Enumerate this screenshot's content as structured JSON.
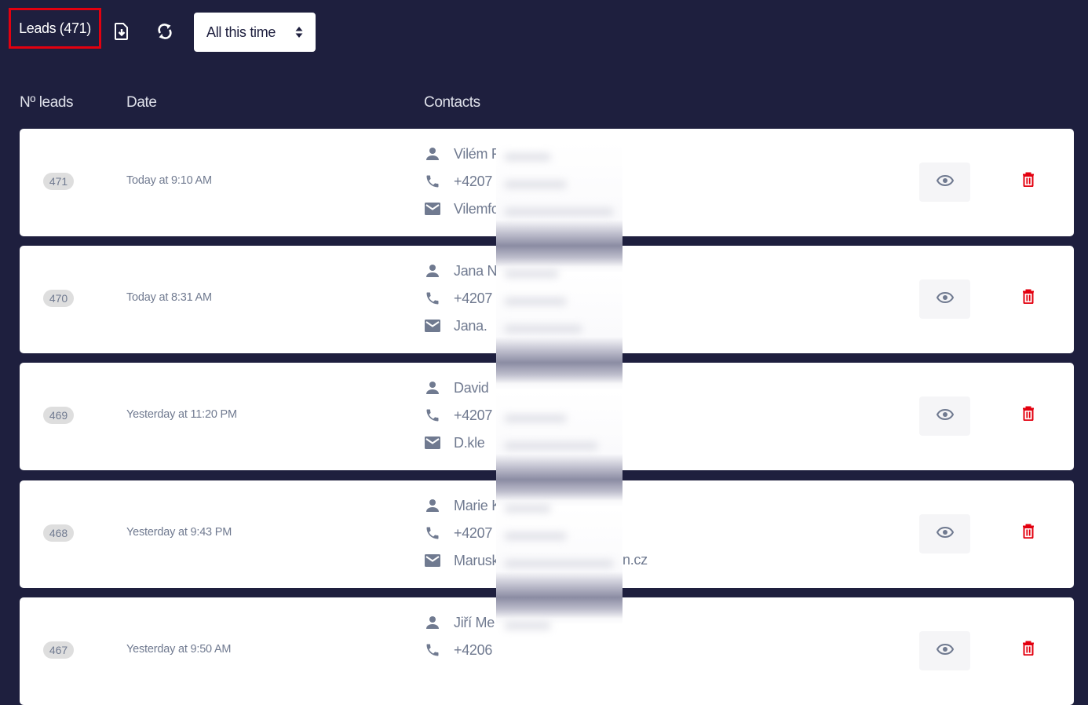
{
  "header": {
    "title": "Leads (471)",
    "export_icon": "file-download-icon",
    "refresh_icon": "sync-icon",
    "period_select": {
      "value": "All this time",
      "icon": "sort-caret-icon"
    }
  },
  "columns": {
    "number": "Nº leads",
    "date": "Date",
    "contacts": "Contacts"
  },
  "colors": {
    "background": "#1e1f3e",
    "card": "#ffffff",
    "muted_text": "#707a90",
    "badge_bg": "#dedede",
    "delete": "#e3000f",
    "highlight_border": "#e3000f"
  },
  "leads": [
    {
      "number": "471",
      "date": "Today at 9:10 AM",
      "name": "Vilém F",
      "phone": "+4207",
      "email": "Vilemfo"
    },
    {
      "number": "470",
      "date": "Today at 8:31 AM",
      "name": "Jana N",
      "phone": "+4207",
      "email": "Jana."
    },
    {
      "number": "469",
      "date": "Yesterday at 11:20 PM",
      "name": "David",
      "phone": "+4207",
      "email": "D.kle"
    },
    {
      "number": "468",
      "date": "Yesterday at 9:43 PM",
      "name": "Marie K",
      "phone": "+4207",
      "email": "Marusk",
      "email_tail": "n.cz"
    },
    {
      "number": "467",
      "date": "Yesterday at 9:50 AM",
      "name": "Jiří Me",
      "phone": "+4206"
    }
  ],
  "row_actions": {
    "view_icon": "eye-icon",
    "delete_icon": "trash-icon"
  }
}
